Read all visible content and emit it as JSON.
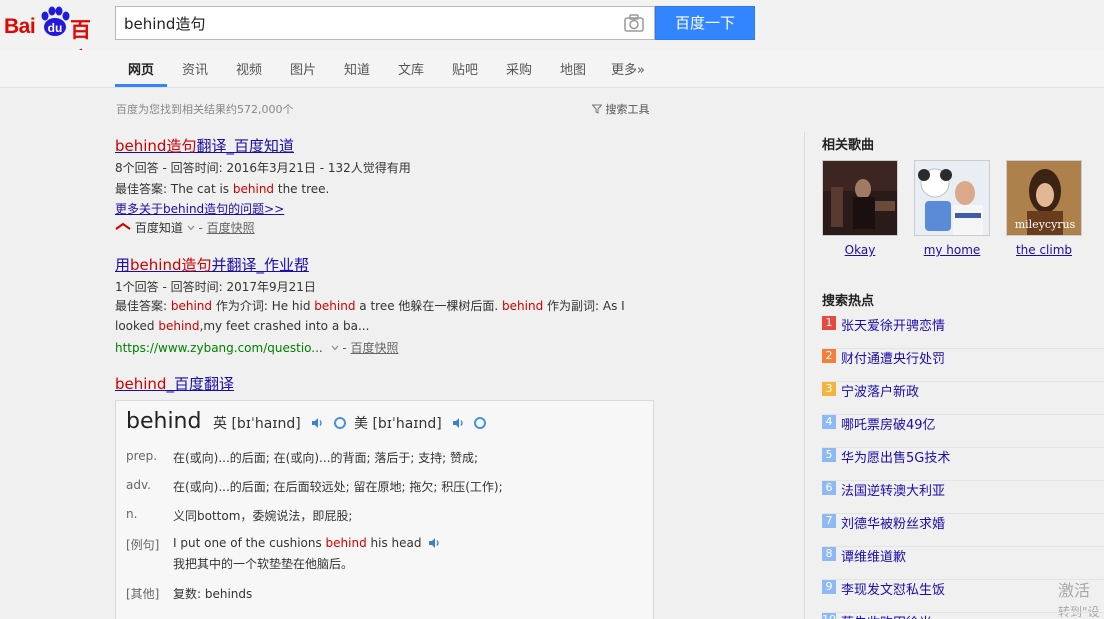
{
  "header": {
    "logo_text_left": "Bai",
    "logo_text_paw": "du",
    "logo_text_right": "百度",
    "search_value": "behind造句",
    "camera_icon": "camera-icon",
    "search_button": "百度一下"
  },
  "nav": {
    "tabs": [
      {
        "label": "网页"
      },
      {
        "label": "资讯"
      },
      {
        "label": "视频"
      },
      {
        "label": "图片"
      },
      {
        "label": "知道"
      },
      {
        "label": "文库"
      },
      {
        "label": "贴吧"
      },
      {
        "label": "采购"
      },
      {
        "label": "地图"
      },
      {
        "label": "更多»"
      }
    ]
  },
  "meta": {
    "result_count": "百度为您找到相关结果约572,000个",
    "search_tools": "搜索工具"
  },
  "results": [
    {
      "title_a": "behind造句",
      "title_b": "翻译_百度知道",
      "meta": "8个回答 - 回答时间: 2016年3月21日 - 132人觉得有用",
      "answer_prefix": "最佳答案: The cat is ",
      "answer_em": "behind",
      "answer_suffix": " the tree.",
      "more_link": "更多关于behind造句的问题>>",
      "source": "百度知道",
      "kuaizhao": "百度快照"
    },
    {
      "title_a": "用",
      "title_b": "behind造句",
      "title_c": "并翻译_作业帮",
      "meta": "1个回答 - 回答时间: 2017年9月21日",
      "line1_a": "最佳答案: ",
      "line1_em1": "behind",
      "line1_b": " 作为介词:  He hid ",
      "line1_em2": "behind",
      "line1_c": " a tree 他躲在一棵树后面. ",
      "line1_em3": "behind",
      "line1_d": " 作为副词:   As I",
      "line2_a": "looked ",
      "line2_em": "behind",
      "line2_b": ",my feet crashed into a ba...",
      "url": "https://www.zybang.com/questio...",
      "kuaizhao": "百度快照"
    },
    {
      "title_a": "behind",
      "title_b": "_百度翻译"
    }
  ],
  "dict": {
    "word": "behind",
    "uk_label": "英",
    "uk_phon": "[bɪˈhaɪnd]",
    "us_label": "美",
    "us_phon": "[bɪˈhaɪnd]",
    "defs": [
      {
        "pos": "prep.",
        "text": "在(或向)...的后面; 在(或向)...的背面; 落后于; 支持; 赞成;"
      },
      {
        "pos": "adv.",
        "text": "在(或向)...的后面; 在后面较远处; 留在原地; 拖欠; 积压(工作);"
      },
      {
        "pos": "n.",
        "text": "义同bottom，委婉说法，即屁股;"
      }
    ],
    "example_label": "[例句]",
    "example_a": "I put one of the cushions ",
    "example_em": "behind",
    "example_b": " his head",
    "example_cn": "我把其中的一个软垫垫在他脑后。",
    "other_label": "[其他]",
    "other_text": "复数: behinds"
  },
  "sidebar": {
    "songs_heading": "相关歌曲",
    "songs": [
      {
        "label": "Okay"
      },
      {
        "label": "my home"
      },
      {
        "label": "the climb"
      }
    ],
    "album3_overlay": "mileycyrus",
    "hot_heading": "搜索热点",
    "hot": [
      {
        "rank": "1",
        "text": "张天爱徐开骋恋情",
        "color": "#e5493f"
      },
      {
        "rank": "2",
        "text": "财付通遭央行处罚",
        "color": "#f57f3a"
      },
      {
        "rank": "3",
        "text": "宁波落户新政",
        "color": "#f4b33d"
      },
      {
        "rank": "4",
        "text": "哪吒票房破49亿",
        "color": "#8eb9f5"
      },
      {
        "rank": "5",
        "text": "华为愿出售5G技术",
        "color": "#8eb9f5"
      },
      {
        "rank": "6",
        "text": "法国逆转澳大利亚",
        "color": "#8eb9f5"
      },
      {
        "rank": "7",
        "text": "刘德华被粉丝求婚",
        "color": "#8eb9f5"
      },
      {
        "rank": "8",
        "text": "谭维维道歉",
        "color": "#8eb9f5"
      },
      {
        "rank": "9",
        "text": "李现发文怼私生饭",
        "color": "#8eb9f5"
      },
      {
        "rank": "10",
        "text": "蔡失收购田徐光",
        "color": "#8eb9f5"
      }
    ]
  },
  "watermark": {
    "line1": "激活",
    "line2": "转到\"设"
  }
}
